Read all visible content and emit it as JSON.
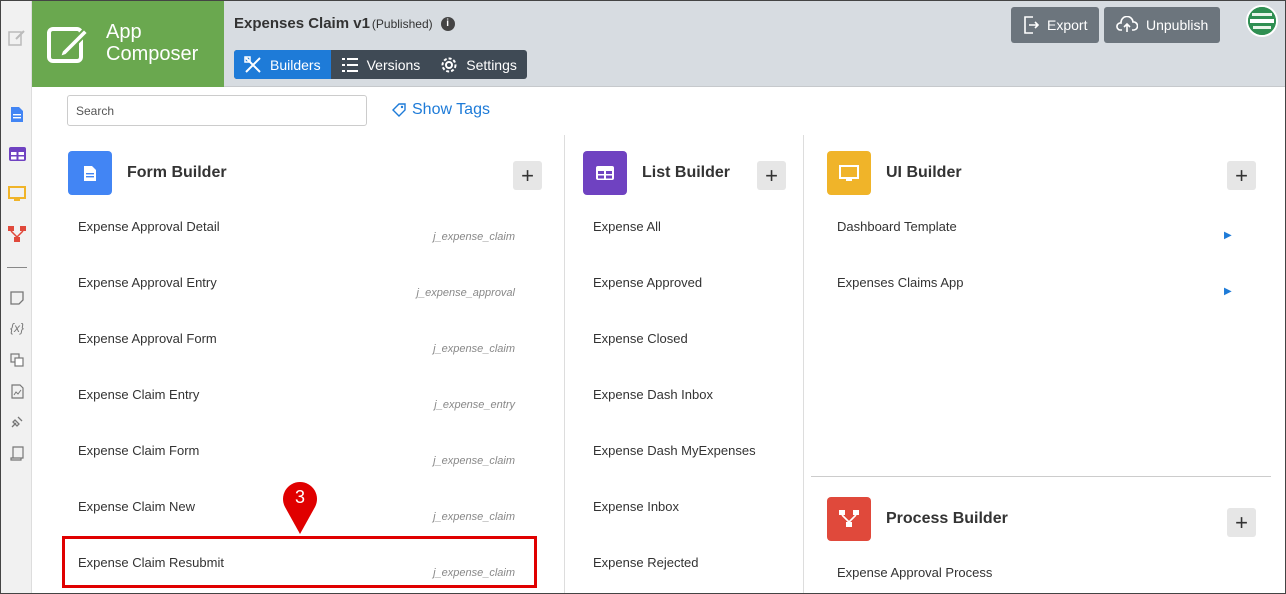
{
  "app": {
    "logo_line1": "App",
    "logo_line2": "Composer",
    "title": "Expenses Claim v1",
    "status": "(Published)",
    "info_glyph": "i"
  },
  "tabs": [
    {
      "label": "Builders",
      "icon": "builders-icon",
      "active": true
    },
    {
      "label": "Versions",
      "icon": "list-icon",
      "active": false
    },
    {
      "label": "Settings",
      "icon": "gear-icon",
      "active": false
    }
  ],
  "actions": {
    "export_label": "Export",
    "unpublish_label": "Unpublish"
  },
  "search": {
    "placeholder": "Search"
  },
  "show_tags_label": "Show Tags",
  "sections": {
    "form": {
      "title": "Form Builder",
      "color": "#4285f4",
      "items": [
        {
          "label": "Expense Approval Detail",
          "tag": "j_expense_claim"
        },
        {
          "label": "Expense Approval Entry",
          "tag": "j_expense_approval"
        },
        {
          "label": "Expense Approval Form",
          "tag": "j_expense_claim"
        },
        {
          "label": "Expense Claim Entry",
          "tag": "j_expense_entry"
        },
        {
          "label": "Expense Claim Form",
          "tag": "j_expense_claim"
        },
        {
          "label": "Expense Claim New",
          "tag": "j_expense_claim"
        },
        {
          "label": "Expense Claim Resubmit",
          "tag": "j_expense_claim"
        }
      ]
    },
    "list": {
      "title": "List Builder",
      "color": "#6f42c1",
      "items": [
        {
          "label": "Expense All"
        },
        {
          "label": "Expense Approved"
        },
        {
          "label": "Expense Closed"
        },
        {
          "label": "Expense Dash Inbox"
        },
        {
          "label": "Expense Dash MyExpenses"
        },
        {
          "label": "Expense Inbox"
        },
        {
          "label": "Expense Rejected"
        }
      ]
    },
    "ui": {
      "title": "UI Builder",
      "color": "#f0b429",
      "items": [
        {
          "label": "Dashboard Template"
        },
        {
          "label": "Expenses Claims App"
        }
      ]
    },
    "process": {
      "title": "Process Builder",
      "color": "#e0493b",
      "items": [
        {
          "label": "Expense Approval Process"
        }
      ]
    }
  },
  "callout": {
    "number": "3",
    "color": "#e00000"
  },
  "colors": {
    "accent": "#1e7bd8",
    "logo_bg": "#6aa84f",
    "header_bg": "#d7dce1"
  }
}
